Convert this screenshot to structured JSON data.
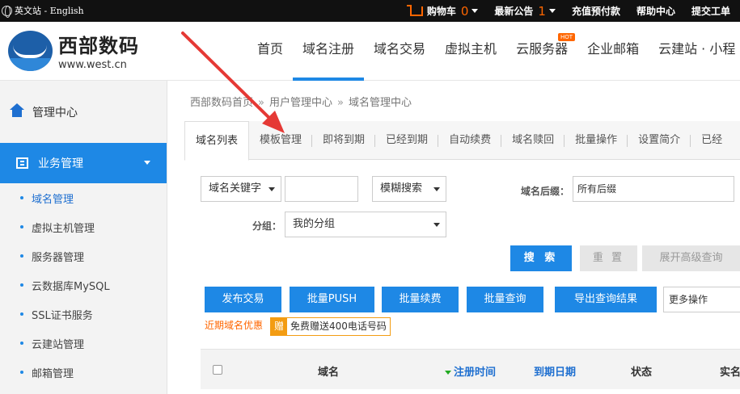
{
  "topbar": {
    "lang": "英文站 - English",
    "cart": "购物车",
    "cart_count": "0",
    "notice": "最新公告",
    "notice_count": "1",
    "recharge": "充值预付款",
    "help": "帮助中心",
    "ticket": "提交工单"
  },
  "logo": {
    "cn": "西部数码",
    "en": "www.west.cn"
  },
  "nav": {
    "items": [
      "首页",
      "域名注册",
      "域名交易",
      "虚拟主机",
      "云服务器",
      "企业邮箱",
      "云建站 · 小程"
    ],
    "hot_badge": "HOT"
  },
  "sidebar": {
    "home": "管理中心",
    "business": "业务管理",
    "items": [
      "域名管理",
      "虚拟主机管理",
      "服务器管理",
      "云数据库MySQL",
      "SSL证书服务",
      "云建站管理",
      "邮箱管理"
    ]
  },
  "breadcrumb": [
    "西部数码首页",
    "用户管理中心",
    "域名管理中心"
  ],
  "tabs": [
    "域名列表",
    "模板管理",
    "即将到期",
    "已经到期",
    "自动续费",
    "域名赎回",
    "批量操作",
    "设置简介",
    "已经"
  ],
  "filters": {
    "keyword_type": "域名关键字",
    "keyword_value": "",
    "match_mode": "模糊搜索",
    "suffix_label": "域名后缀：",
    "suffix_value": "所有后缀",
    "group_label": "分组：",
    "group_value": "我的分组"
  },
  "buttons": {
    "search": "搜 索",
    "reset": "重 置",
    "advanced": "展开高级查询",
    "publish": "发布交易",
    "batch_push": "批量PUSH",
    "batch_renew": "批量续费",
    "batch_query": "批量查询",
    "export": "导出查询结果",
    "more": "更多操作"
  },
  "promo": {
    "text": "近期域名优惠",
    "gift_tag": "赠",
    "gift_text": "免费赠送400电话号码"
  },
  "table": {
    "headers": [
      "域名",
      "注册时间",
      "到期日期",
      "状态",
      "实名"
    ]
  },
  "colors": {
    "accent": "#1e88e5",
    "orange": "#ff6600",
    "annotation": "#e53935"
  }
}
